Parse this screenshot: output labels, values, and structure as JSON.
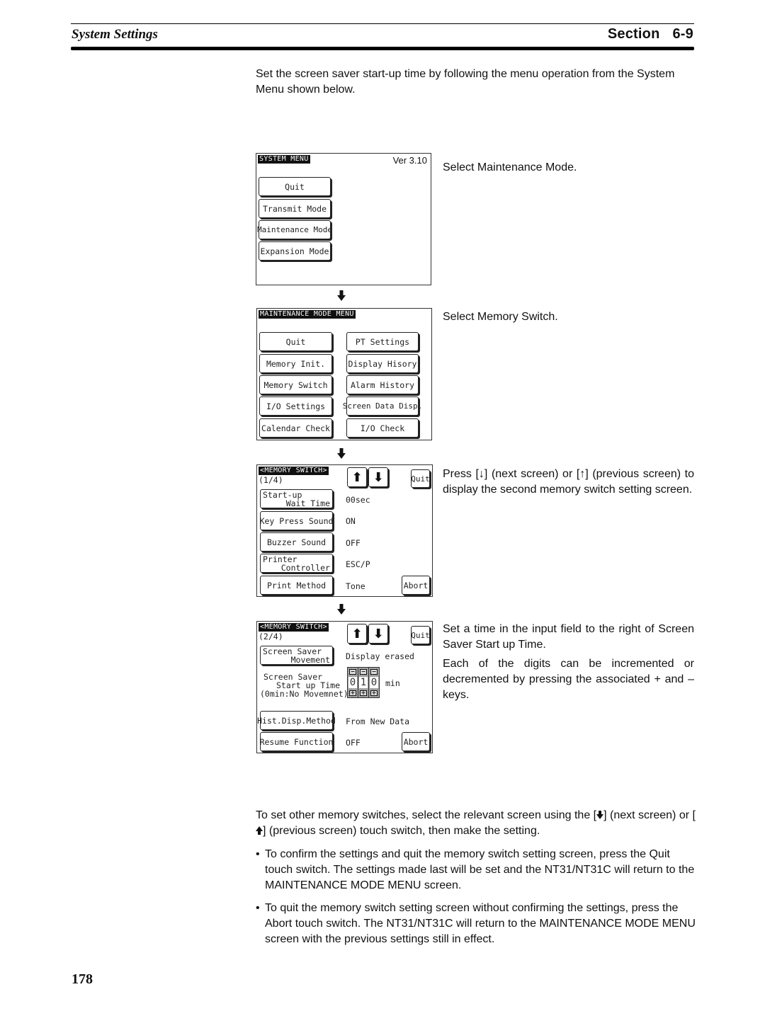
{
  "header": {
    "title": "System Settings",
    "section_label": "Section",
    "section_number": "6-9"
  },
  "intro": "Set the screen saver start-up time by following the menu operation from the System Menu shown below.",
  "steps": [
    {
      "description": "Select Maintenance Mode.",
      "screen": {
        "title": "SYSTEM MENU",
        "version": "Ver 3.10",
        "buttons": [
          "Quit",
          "Transmit Mode",
          "Maintenance Mode",
          "Expansion Mode"
        ]
      }
    },
    {
      "description": "Select Memory Switch.",
      "screen": {
        "title": "MAINTENANCE MODE MENU",
        "left_buttons": [
          "Quit",
          "Memory Init.",
          "Memory Switch",
          "I/O Settings",
          "Calendar Check"
        ],
        "right_buttons": [
          "PT Settings",
          "Display Hisory",
          "Alarm History",
          "Screen Data Disp.",
          "I/O Check"
        ]
      }
    },
    {
      "description": "Press [↓] (next screen) or [↑] (previous screen) to display the second memory switch setting screen.",
      "screen": {
        "title": "<MEMORY SWITCH>",
        "page": "(1/4)",
        "up_icon": "arrow-up-icon",
        "down_icon": "arrow-down-icon",
        "quit_label": "Quit",
        "abort_label": "Abort",
        "rows": [
          {
            "label_l1": "Start-up",
            "label_l2": "Wait Time",
            "value": "00sec"
          },
          {
            "label": "Key Press Sound",
            "value": "ON"
          },
          {
            "label": "Buzzer Sound",
            "value": "OFF"
          },
          {
            "label_l1": "Printer",
            "label_l2": "Controller",
            "value": "ESC/P"
          },
          {
            "label": "Print Method",
            "value": "Tone"
          }
        ]
      }
    },
    {
      "description_1": "Set a time in the input field to the right of Screen Saver Start up Time.",
      "description_2": "Each of the digits can be incremented or decremented by pressing the associated + and – keys.",
      "screen": {
        "title": "<MEMORY SWITCH>",
        "page": "(2/4)",
        "quit_label": "Quit",
        "abort_label": "Abort",
        "movement": {
          "label_l1": "Screen Saver",
          "label_l2": "Movement",
          "value": "Display erased"
        },
        "start_up_time": {
          "label_l1": "Screen Saver",
          "label_l2": "Start up Time",
          "label_l3": "(0min:No Movemnet)",
          "digits": [
            "0",
            "1",
            "0"
          ],
          "minus_key": "−",
          "plus_key": "+",
          "unit": "min"
        },
        "hist": {
          "label": "Hist.Disp.Method",
          "value": "From New Data"
        },
        "resume": {
          "label": "Resume Function",
          "value": "OFF"
        }
      }
    }
  ],
  "other_switches": {
    "part1": "To set other memory switches, select the relevant screen using the [",
    "part2": "] (next screen) or [",
    "part3": "] (previous screen) touch switch, then make the setting."
  },
  "bullets": [
    "To confirm the settings and quit the memory switch setting screen, press the Quit touch switch. The settings made last will be set and the NT31/NT31C will return to the MAINTENANCE MODE MENU screen.",
    "To quit the memory switch setting screen without confirming the settings, press the Abort touch switch. The NT31/NT31C will return to the MAINTENANCE MODE MENU screen with the previous settings still in effect."
  ],
  "bullet_glyph": "•",
  "page_number": "178"
}
